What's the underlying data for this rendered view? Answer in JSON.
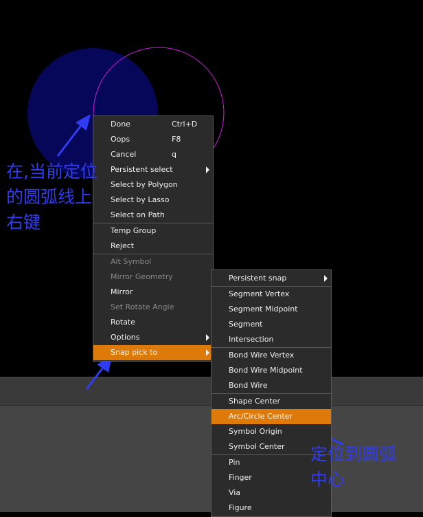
{
  "context_menu": {
    "items": [
      {
        "label": "Done",
        "shortcut": "Ctrl+D"
      },
      {
        "label": "Oops",
        "shortcut": "F8"
      },
      {
        "label": "Cancel",
        "shortcut": "q"
      },
      {
        "label": "Persistent select"
      },
      {
        "label": "Select by Polygon"
      },
      {
        "label": "Select by Lasso"
      },
      {
        "label": "Select on Path"
      },
      {
        "label": "Temp Group"
      },
      {
        "label": "Reject"
      },
      {
        "label": "Alt Symbol"
      },
      {
        "label": "Mirror Geometry"
      },
      {
        "label": "Mirror"
      },
      {
        "label": "Set Rotate Angle"
      },
      {
        "label": "Rotate"
      },
      {
        "label": "Options"
      },
      {
        "label": "Snap pick to"
      }
    ]
  },
  "snap_menu": {
    "items": [
      {
        "label": "Persistent snap"
      },
      {
        "label": "Segment Vertex"
      },
      {
        "label": "Segment Midpoint"
      },
      {
        "label": "Segment"
      },
      {
        "label": "Intersection"
      },
      {
        "label": "Bond Wire Vertex"
      },
      {
        "label": "Bond Wire Midpoint"
      },
      {
        "label": "Bond Wire"
      },
      {
        "label": "Shape Center"
      },
      {
        "label": "Arc/Circle Center"
      },
      {
        "label": "Symbol Origin"
      },
      {
        "label": "Symbol Center"
      },
      {
        "label": "Pin"
      },
      {
        "label": "Finger"
      },
      {
        "label": "Via"
      },
      {
        "label": "Figure"
      }
    ]
  },
  "annotations": {
    "note1_lines": [
      "在,当前定位",
      "的圆弧线上",
      "右键"
    ],
    "note2_lines": [
      "定位到圆弧",
      "中心"
    ]
  },
  "colors": {
    "highlight": "#dd7a0a",
    "annotation": "#2f3cf0",
    "filled_circle": "#07075a",
    "arc_outline": "#c81fd2"
  }
}
